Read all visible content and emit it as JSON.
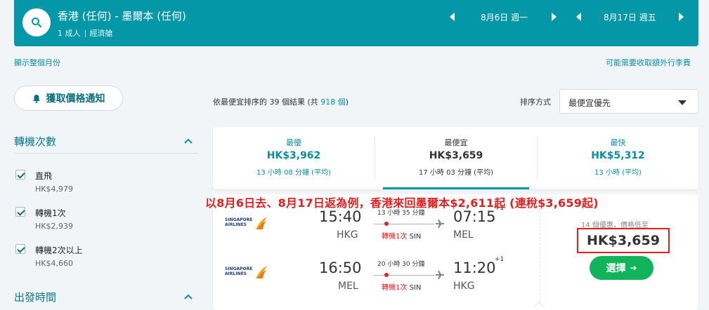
{
  "header": {
    "route": "香港 (任何) - 墨爾本 (任何)",
    "passengers": "1 成人",
    "cabin": "經濟艙",
    "depart_date": "8月6日 週一",
    "return_date": "8月17日 週五"
  },
  "links": {
    "show_month": "顯示整個月份",
    "baggage_fee": "可能需要收取額外行李費"
  },
  "sidebar": {
    "price_alert": "獲取價格通知",
    "stops_heading": "轉機次數",
    "stops": [
      {
        "label": "直飛",
        "price": "HK$4,979"
      },
      {
        "label": "轉機1次",
        "price": "HK$2,939"
      },
      {
        "label": "轉機2次以上",
        "price": "HK$4,660"
      }
    ],
    "depart_heading": "出發時間"
  },
  "summary": {
    "prefix": "依",
    "bold": "最便宜",
    "mid": "排序的 39 個結果 (共 ",
    "total": "918 個",
    "suffix": ")"
  },
  "sort": {
    "label": "排序方式",
    "value": "最便宜優先"
  },
  "tabs": [
    {
      "title": "最優",
      "price": "HK$3,962",
      "duration": "13 小時 08 分鐘 (平均)"
    },
    {
      "title": "最便宜",
      "price": "HK$3,659",
      "duration": "17 小時 03 分鐘 (平均)"
    },
    {
      "title": "最快",
      "price": "HK$5,312",
      "duration": "13 小時 (平均)"
    }
  ],
  "overlay_text": "以8月6日去、8月17日返為例，香港來回墨爾本$2,611起 (連稅$3,659起)",
  "result": {
    "airline_line1": "SINGAPORE",
    "airline_line2": "AIRLINES",
    "outbound": {
      "dep_time": "15:40",
      "dep_code": "HKG",
      "duration": "13 小時 35 分鐘",
      "stops": "轉機1次",
      "via": "SIN",
      "arr_time": "07:15",
      "arr_sup": "+1",
      "arr_code": "MEL"
    },
    "inbound": {
      "dep_time": "16:50",
      "dep_code": "MEL",
      "duration": "20 小時 30 分鐘",
      "stops": "轉機1次",
      "via": "SIN",
      "arr_time": "11:20",
      "arr_sup": "+1",
      "arr_code": "HKG"
    },
    "deals": "14 個優惠，價格低至",
    "price": "HK$3,659",
    "select_label": "選擇"
  },
  "colors": {
    "header": "#0397a8",
    "accent": "#0a8ea1",
    "highlight": "#e02020",
    "select": "#11b35b"
  }
}
